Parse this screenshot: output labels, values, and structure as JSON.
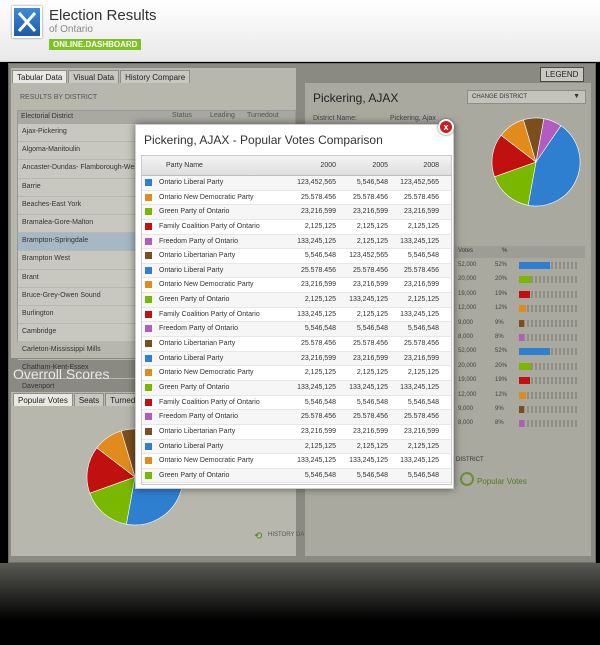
{
  "header": {
    "title": "Election Results",
    "subtitle": "of Ontario",
    "badge": "ONLINE.DASHBOARD"
  },
  "left_panel": {
    "tabs": [
      "Tabular Data",
      "Visual Data",
      "History Compare"
    ],
    "results_label": "RESULTS BY DISTRICT",
    "columns": [
      "Electorial District",
      "Status",
      "Leading",
      "Turnedout"
    ],
    "districts": [
      "Ajax-Pickering",
      "Algoma-Manitoulin",
      "Ancaster-Dundas- Flamborough-Westdale",
      "Barrie",
      "Beaches-East York",
      "Bramalea-Gore-Malton",
      "Brampton-Springdale",
      "Brampton West",
      "Brant",
      "Bruce-Grey-Owen Sound",
      "Burlington",
      "Cambridge",
      "Carleton-Mississippi Mills",
      "Chatham-Kent-Essex",
      "Davenport"
    ],
    "selected_district": "Brampton-Springdale"
  },
  "overall": {
    "title": "Overroll Scores",
    "tabs": [
      "Popular Votes",
      "Seats",
      "Turned out"
    ],
    "history_link": "HISTORY DATA"
  },
  "right_panel": {
    "legend_label": "LEGEND",
    "title": "Pickering, AJAX",
    "change_district": "CHANGE DISTRICT",
    "district_name_label": "District Name:",
    "district_name_value": "Pickering, Ajax",
    "votes_col": "Votes",
    "pct_col": "%",
    "votes_rows": [
      {
        "votes": "52,000",
        "pct": "52%",
        "color": "#2f7fd1",
        "fraction": 0.52
      },
      {
        "votes": "20,000",
        "pct": "20%",
        "color": "#7ab800",
        "fraction": 0.2
      },
      {
        "votes": "19,000",
        "pct": "19%",
        "color": "#c01010",
        "fraction": 0.19
      },
      {
        "votes": "12,000",
        "pct": "12%",
        "color": "#e08b1c",
        "fraction": 0.12
      },
      {
        "votes": "9,000",
        "pct": "9%",
        "color": "#7a4e1e",
        "fraction": 0.09
      },
      {
        "votes": "8,000",
        "pct": "8%",
        "color": "#b05cc0",
        "fraction": 0.08
      },
      {
        "votes": "52,000",
        "pct": "52%",
        "color": "#2f7fd1",
        "fraction": 0.52
      },
      {
        "votes": "20,000",
        "pct": "20%",
        "color": "#7ab800",
        "fraction": 0.2
      },
      {
        "votes": "19,000",
        "pct": "19%",
        "color": "#c01010",
        "fraction": 0.19
      },
      {
        "votes": "12,000",
        "pct": "12%",
        "color": "#e08b1c",
        "fraction": 0.12
      },
      {
        "votes": "9,000",
        "pct": "9%",
        "color": "#7a4e1e",
        "fraction": 0.09
      },
      {
        "votes": "8,000",
        "pct": "8%",
        "color": "#b05cc0",
        "fraction": 0.08
      }
    ],
    "district_label": "DISTRICT",
    "popular_votes_label": "Popular Votes"
  },
  "modal": {
    "title": "Pickering, AJAX - Popular Votes Comparison",
    "close_label": "x",
    "columns": [
      "Party Name",
      "2000",
      "2005",
      "2008"
    ],
    "rows": [
      {
        "party": "Ontario Liberal Party",
        "color": "#2f7fd1",
        "y2000": "123,452,565",
        "y2005": "5,546,548",
        "y2008": "123,452,565"
      },
      {
        "party": "Ontario New Democratic Party",
        "color": "#e08b1c",
        "y2000": "25.578.456",
        "y2005": "25.578.456",
        "y2008": "25.578.456"
      },
      {
        "party": "Green Party of Ontario",
        "color": "#7ab800",
        "y2000": "23,216,599",
        "y2005": "23,216,599",
        "y2008": "23,216,599"
      },
      {
        "party": "Family Coalition Party of Ontario",
        "color": "#c01010",
        "y2000": "2,125,125",
        "y2005": "2,125,125",
        "y2008": "2,125,125"
      },
      {
        "party": "Freedom Party of Ontario",
        "color": "#b05cc0",
        "y2000": "133,245,125",
        "y2005": "2,125,125",
        "y2008": "133,245,125"
      },
      {
        "party": "Ontario Libertarian Party",
        "color": "#7a4e1e",
        "y2000": "5,546,548",
        "y2005": "123,452,565",
        "y2008": "5,546,548"
      },
      {
        "party": "Ontario Liberal Party",
        "color": "#2f7fd1",
        "y2000": "25.578.456",
        "y2005": "25.578.456",
        "y2008": "25.578.456"
      },
      {
        "party": "Ontario New Democratic Party",
        "color": "#e08b1c",
        "y2000": "23,216,599",
        "y2005": "23,216,599",
        "y2008": "23,216,599"
      },
      {
        "party": "Green Party of Ontario",
        "color": "#7ab800",
        "y2000": "2,125,125",
        "y2005": "133,245,125",
        "y2008": "2,125,125"
      },
      {
        "party": "Family Coalition Party of Ontario",
        "color": "#c01010",
        "y2000": "133,245,125",
        "y2005": "2,125,125",
        "y2008": "133,245,125"
      },
      {
        "party": "Freedom Party of Ontario",
        "color": "#b05cc0",
        "y2000": "5,546,548",
        "y2005": "5,546,548",
        "y2008": "5,546,548"
      },
      {
        "party": "Ontario Libertarian Party",
        "color": "#7a4e1e",
        "y2000": "25.578.456",
        "y2005": "25.578.456",
        "y2008": "25.578.456"
      },
      {
        "party": "Ontario Liberal Party",
        "color": "#2f7fd1",
        "y2000": "23,216,599",
        "y2005": "23,216,599",
        "y2008": "23,216,599"
      },
      {
        "party": "Ontario New Democratic Party",
        "color": "#e08b1c",
        "y2000": "2,125,125",
        "y2005": "2,125,125",
        "y2008": "2,125,125"
      },
      {
        "party": "Green Party of Ontario",
        "color": "#7ab800",
        "y2000": "133,245,125",
        "y2005": "133,245,125",
        "y2008": "133,245,125"
      },
      {
        "party": "Family Coalition Party of Ontario",
        "color": "#c01010",
        "y2000": "5,546,548",
        "y2005": "5,546,548",
        "y2008": "5,546,548"
      },
      {
        "party": "Freedom Party of Ontario",
        "color": "#b05cc0",
        "y2000": "25.578.456",
        "y2005": "25.578.456",
        "y2008": "25.578.456"
      },
      {
        "party": "Ontario Libertarian Party",
        "color": "#7a4e1e",
        "y2000": "23,216,599",
        "y2005": "23,216,599",
        "y2008": "23,216,599"
      },
      {
        "party": "Ontario Liberal Party",
        "color": "#2f7fd1",
        "y2000": "2,125,125",
        "y2005": "2,125,125",
        "y2008": "2,125,125"
      },
      {
        "party": "Ontario New Democratic Party",
        "color": "#e08b1c",
        "y2000": "133,245,125",
        "y2005": "133,245,125",
        "y2008": "133,245,125"
      },
      {
        "party": "Green Party of Ontario",
        "color": "#7ab800",
        "y2000": "5,546,548",
        "y2005": "5,546,548",
        "y2008": "5,546,548"
      }
    ]
  },
  "pie_colors": [
    "#2f7fd1",
    "#7ab800",
    "#c01010",
    "#e08b1c",
    "#7a4e1e",
    "#b05cc0"
  ],
  "pie_shares": [
    0.52,
    0.2,
    0.19,
    0.12,
    0.09,
    0.08
  ]
}
